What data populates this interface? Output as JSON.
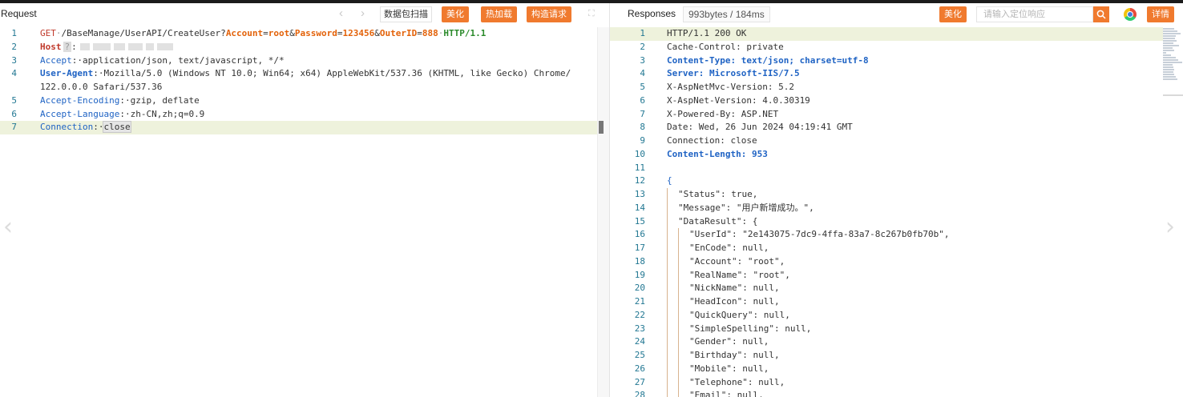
{
  "request": {
    "title": "Request",
    "toolbar": {
      "prev_icon": "chevron-left-icon",
      "next_icon": "chevron-right-icon",
      "scan_label": "数据包扫描",
      "beautify_label": "美化",
      "hotload_label": "热加载",
      "construct_label": "构造请求",
      "expand_icon": "expand-icon"
    },
    "lines": [
      {
        "n": "1",
        "method": "GET",
        "path": "/BaseManage/UserAPI/CreateUser?",
        "params": [
          {
            "k": "Account",
            "v": "root"
          },
          {
            "k": "Password",
            "v": "123456"
          },
          {
            "k": "OuterID",
            "v": "888"
          }
        ],
        "version": "HTTP/1.1"
      },
      {
        "n": "2",
        "key": "Host",
        "value": ""
      },
      {
        "n": "3",
        "key": "Accept",
        "value": "application/json, text/javascript, */*"
      },
      {
        "n": "4",
        "key": "User-Agent",
        "value": "Mozilla/5.0 (Windows NT 10.0; Win64; x64) AppleWebKit/537.36 (KHTML, like Gecko) Chrome/"
      },
      {
        "n": "",
        "value": "122.0.0.0 Safari/537.36"
      },
      {
        "n": "5",
        "key": "Accept-Encoding",
        "value": "gzip, deflate"
      },
      {
        "n": "6",
        "key": "Accept-Language",
        "value": "zh-CN,zh;q=0.9"
      },
      {
        "n": "7",
        "key": "Connection",
        "value": "close"
      }
    ]
  },
  "response": {
    "title": "Responses",
    "size_badge": "993bytes / 184ms",
    "beautify_label": "美化",
    "search_placeholder": "请输入定位响应",
    "search_icon": "search-icon",
    "browser_icon": "chrome-icon",
    "details_label": "详情",
    "lines": [
      {
        "n": "1",
        "text": "HTTP/1.1 200 OK"
      },
      {
        "n": "2",
        "text": "Cache-Control: private"
      },
      {
        "n": "3",
        "text": "Content-Type: text/json; charset=utf-8"
      },
      {
        "n": "4",
        "text": "Server: Microsoft-IIS/7.5"
      },
      {
        "n": "5",
        "text": "X-AspNetMvc-Version: 5.2"
      },
      {
        "n": "6",
        "text": "X-AspNet-Version: 4.0.30319"
      },
      {
        "n": "7",
        "text": "X-Powered-By: ASP.NET"
      },
      {
        "n": "8",
        "text": "Date: Wed, 26 Jun 2024 04:19:41 GMT"
      },
      {
        "n": "9",
        "text": "Connection: close"
      },
      {
        "n": "10",
        "text": "Content-Length: 953"
      },
      {
        "n": "11",
        "text": ""
      },
      {
        "n": "12",
        "text": "{"
      },
      {
        "n": "13",
        "text": "\"Status\": true,"
      },
      {
        "n": "14",
        "text": "\"Message\": \"用户新增成功。\","
      },
      {
        "n": "15",
        "text": "\"DataResult\": {"
      },
      {
        "n": "16",
        "text": "\"UserId\": \"2e143075-7dc9-4ffa-83a7-8c267b0fb70b\","
      },
      {
        "n": "17",
        "text": "\"EnCode\": null,"
      },
      {
        "n": "18",
        "text": "\"Account\": \"root\","
      },
      {
        "n": "19",
        "text": "\"RealName\": \"root\","
      },
      {
        "n": "20",
        "text": "\"NickName\": null,"
      },
      {
        "n": "21",
        "text": "\"HeadIcon\": null,"
      },
      {
        "n": "22",
        "text": "\"QuickQuery\": null,"
      },
      {
        "n": "23",
        "text": "\"SimpleSpelling\": null,"
      },
      {
        "n": "24",
        "text": "\"Gender\": null,"
      },
      {
        "n": "25",
        "text": "\"Birthday\": null,"
      },
      {
        "n": "26",
        "text": "\"Mobile\": null,"
      },
      {
        "n": "27",
        "text": "\"Telephone\": null,"
      },
      {
        "n": "28",
        "text": "\"Email\": null,"
      }
    ]
  }
}
